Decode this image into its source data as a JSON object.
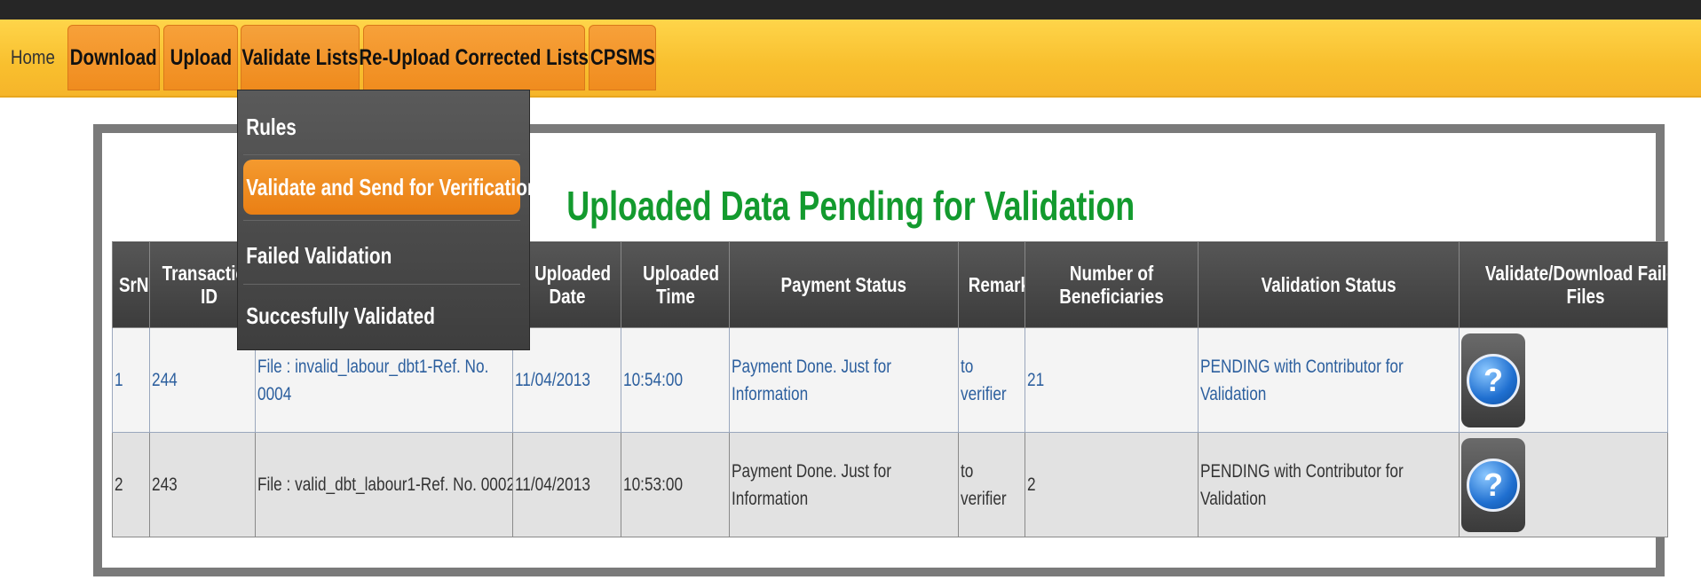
{
  "nav": {
    "home": "Home",
    "tabs": [
      "Download",
      "Upload",
      "Validate Lists",
      "Re-Upload Corrected Lists",
      "CPSMS"
    ]
  },
  "dropdown": {
    "items": [
      "Rules",
      "Validate and Send for Verification",
      "Failed Validation",
      "Succesfully Validated"
    ],
    "highlighted": "Validate and Send for Verification"
  },
  "page": {
    "title": "Uploaded Data Pending for Validation"
  },
  "table": {
    "headers": {
      "srno": "SrNo",
      "transaction_id": "Transaction ID",
      "file": "",
      "uploaded_date": "Uploaded Date",
      "uploaded_time": "Uploaded Time",
      "payment_status": "Payment Status",
      "remarks": "Remarks",
      "beneficiaries": "Number of Beneficiaries",
      "validation_status": "Validation Status",
      "action": "Validate/Download Failed Files"
    },
    "rows": [
      {
        "srno": "1",
        "transaction_id": "244",
        "file": "File : invalid_labour_dbt1-Ref. No. 0004",
        "uploaded_date": "11/04/2013",
        "uploaded_time": "10:54:00",
        "payment_status": "Payment Done. Just for Information",
        "remarks": "to verifier",
        "beneficiaries": "21",
        "validation_status": "PENDING with Contributor for Validation",
        "action_icon": "question-icon"
      },
      {
        "srno": "2",
        "transaction_id": "243",
        "file": "File : valid_dbt_labour1-Ref. No. 0002",
        "uploaded_date": "11/04/2013",
        "uploaded_time": "10:53:00",
        "payment_status": "Payment Done. Just for Information",
        "remarks": "to verifier",
        "beneficiaries": "2",
        "validation_status": "PENDING with Contributor for Validation",
        "action_icon": "question-icon"
      }
    ]
  },
  "colors": {
    "navbar": "#f8bf2e",
    "tab": "#f08c1e",
    "title": "#139a2e",
    "header": "#444444",
    "link_text": "#2c5f9e"
  }
}
